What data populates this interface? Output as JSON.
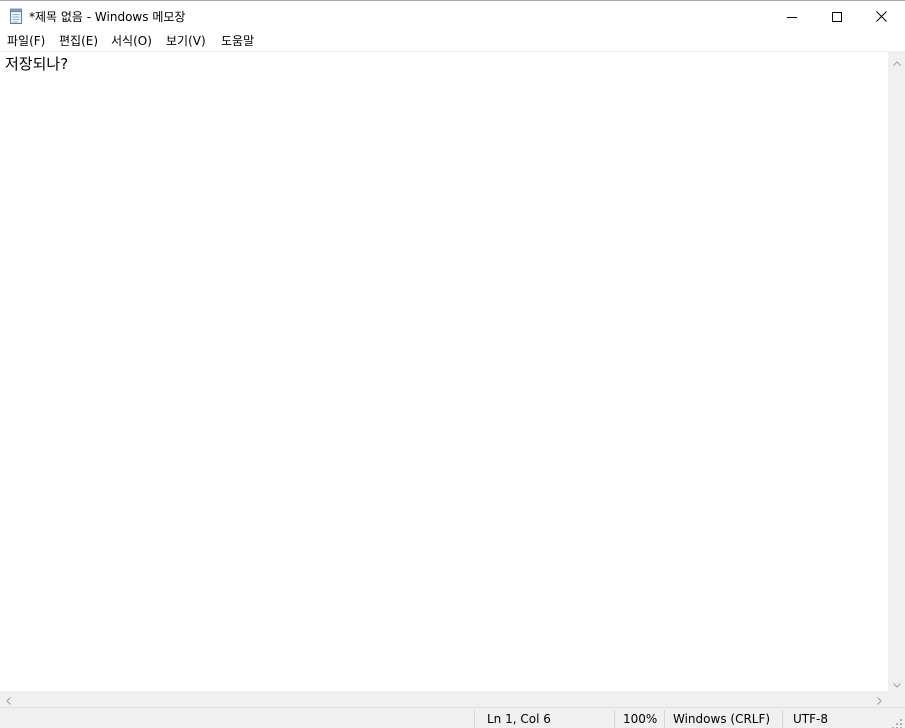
{
  "window": {
    "title": "*제목 없음 - Windows 메모장",
    "icon": "notepad-icon"
  },
  "caption_buttons": {
    "minimize_icon": "minimize-icon",
    "maximize_icon": "maximize-icon",
    "close_icon": "close-icon"
  },
  "menu": {
    "items": [
      {
        "label": "파일(F)"
      },
      {
        "label": "편집(E)"
      },
      {
        "label": "서식(O)"
      },
      {
        "label": "보기(V)"
      },
      {
        "label": "도움말"
      }
    ]
  },
  "editor": {
    "content": "저장되나?"
  },
  "statusbar": {
    "position": "Ln 1, Col 6",
    "zoom": "100%",
    "line_ending": "Windows (CRLF)",
    "encoding": "UTF-8"
  },
  "colors": {
    "background": "#ffffff",
    "chrome": "#f0f0f0",
    "text": "#000000"
  }
}
